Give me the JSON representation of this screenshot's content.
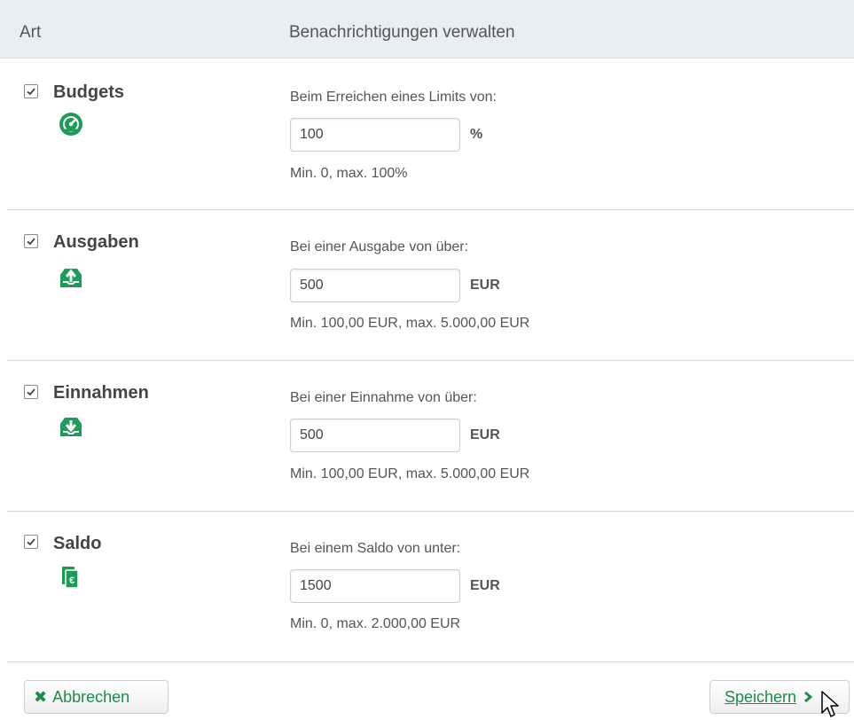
{
  "header": {
    "col_art": "Art",
    "col_manage": "Benachrichtigungen verwalten"
  },
  "rows": [
    {
      "title": "Budgets",
      "checked": true,
      "icon": "gauge-icon",
      "label": "Beim Erreichen eines Limits von:",
      "value": "100",
      "unit": "%",
      "hint": "Min. 0, max. 100%"
    },
    {
      "title": "Ausgaben",
      "checked": true,
      "icon": "tray-out-icon",
      "label": "Bei einer Ausgabe von über:",
      "value": "500",
      "unit": "EUR",
      "hint": "Min. 100,00 EUR, max. 5.000,00 EUR"
    },
    {
      "title": "Einnahmen",
      "checked": true,
      "icon": "tray-in-icon",
      "label": "Bei einer Einnahme von über:",
      "value": "500",
      "unit": "EUR",
      "hint": "Min. 100,00 EUR, max. 5.000,00 EUR"
    },
    {
      "title": "Saldo",
      "checked": true,
      "icon": "euro-cards-icon",
      "label": "Bei einem Saldo von unter:",
      "value": "1500",
      "unit": "EUR",
      "hint": "Min. 0, max. 2.000,00 EUR"
    }
  ],
  "footer": {
    "cancel_label": "Abbrechen",
    "save_label": "Speichern"
  },
  "colors": {
    "accent_green": "#1f8a4c",
    "icon_green": "#1e9a5a",
    "header_bg": "#e7eef5"
  }
}
